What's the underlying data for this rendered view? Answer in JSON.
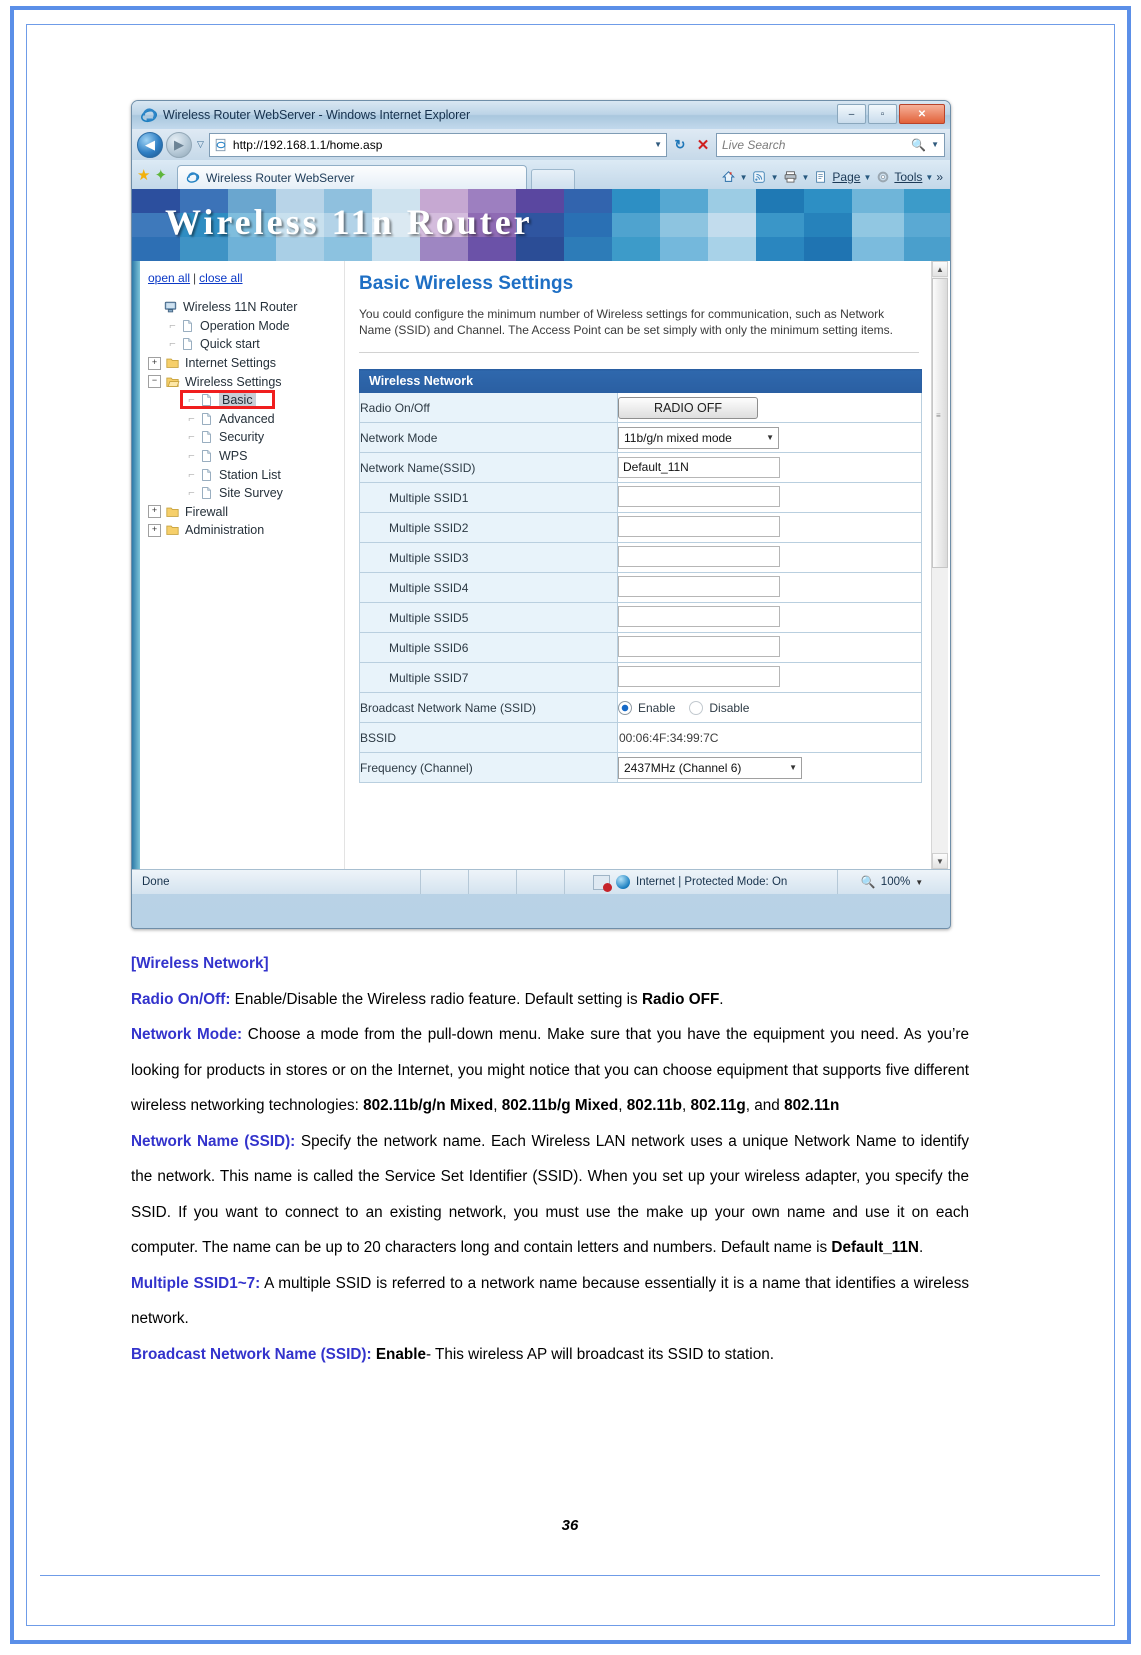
{
  "browser": {
    "window_title": "Wireless Router WebServer - Windows Internet Explorer",
    "minimize_label": "–",
    "maximize_label": "▫",
    "close_label": "✕",
    "back_label": "◀",
    "forward_label": "▶",
    "history_caret": "▽",
    "url": "http://192.168.1.1/home.asp",
    "url_caret": "▼",
    "refresh_label": "↻",
    "stop_label": "✕",
    "search_placeholder": "Live Search",
    "search_icon": "🔍",
    "search_caret": "▼",
    "tab_label": "Wireless Router WebServer",
    "command_bar": [
      {
        "label": "",
        "icon": "home-icon",
        "caret": "▼"
      },
      {
        "label": "",
        "icon": "feeds-icon",
        "caret": "▼"
      },
      {
        "label": "",
        "icon": "print-icon",
        "caret": "▼"
      },
      {
        "label": "Page",
        "icon": "page-icon",
        "caret": "▼"
      },
      {
        "label": "Tools",
        "icon": "tools-icon",
        "caret": "▼"
      },
      {
        "label": "»",
        "icon": "overflow-icon",
        "caret": ""
      }
    ],
    "status": {
      "done": "Done",
      "zone": "Internet | Protected Mode: On",
      "zoom": "100%",
      "zoom_caret": "▼"
    }
  },
  "router": {
    "banner_title": "Wireless 11n Router",
    "open_all": "open all",
    "separator": "|",
    "close_all": "close all",
    "tree": [
      {
        "label": "Wireless 11N Router",
        "level": 1,
        "icon": "computer-icon",
        "expander": "",
        "selected": false
      },
      {
        "label": "Operation Mode",
        "level": 2,
        "icon": "page-icon",
        "expander": "",
        "selected": false
      },
      {
        "label": "Quick start",
        "level": 2,
        "icon": "page-icon",
        "expander": "",
        "selected": false
      },
      {
        "label": "Internet Settings",
        "level": 1,
        "icon": "folder-icon",
        "expander": "+",
        "selected": false
      },
      {
        "label": "Wireless Settings",
        "level": 1,
        "icon": "folder-open-icon",
        "expander": "−",
        "selected": false
      },
      {
        "label": "Basic",
        "level": 3,
        "icon": "page-icon",
        "expander": "",
        "selected": true
      },
      {
        "label": "Advanced",
        "level": 3,
        "icon": "page-icon",
        "expander": "",
        "selected": false
      },
      {
        "label": "Security",
        "level": 3,
        "icon": "page-icon",
        "expander": "",
        "selected": false
      },
      {
        "label": "WPS",
        "level": 3,
        "icon": "page-icon",
        "expander": "",
        "selected": false
      },
      {
        "label": "Station List",
        "level": 3,
        "icon": "page-icon",
        "expander": "",
        "selected": false
      },
      {
        "label": "Site Survey",
        "level": 3,
        "icon": "page-icon",
        "expander": "",
        "selected": false
      },
      {
        "label": "Firewall",
        "level": 1,
        "icon": "folder-icon",
        "expander": "+",
        "selected": false
      },
      {
        "label": "Administration",
        "level": 1,
        "icon": "folder-icon",
        "expander": "+",
        "selected": false
      }
    ],
    "page_title": "Basic Wireless Settings",
    "page_desc": "You could configure the minimum number of Wireless settings for communication, such as Network Name (SSID) and Channel. The Access Point can be set simply with only the minimum setting items.",
    "table_header": "Wireless Network",
    "rows": {
      "radio_label": "Radio On/Off",
      "radio_button": "RADIO OFF",
      "network_mode_label": "Network Mode",
      "network_mode_value": "11b/g/n mixed mode",
      "ssid_label": "Network Name(SSID)",
      "ssid_value": "Default_11N",
      "multi_ssid1_label": "Multiple SSID1",
      "multi_ssid1_value": "",
      "multi_ssid2_label": "Multiple SSID2",
      "multi_ssid2_value": "",
      "multi_ssid3_label": "Multiple SSID3",
      "multi_ssid3_value": "",
      "multi_ssid4_label": "Multiple SSID4",
      "multi_ssid4_value": "",
      "multi_ssid5_label": "Multiple SSID5",
      "multi_ssid5_value": "",
      "multi_ssid6_label": "Multiple SSID6",
      "multi_ssid6_value": "",
      "multi_ssid7_label": "Multiple SSID7",
      "multi_ssid7_value": "",
      "broadcast_label": "Broadcast Network Name (SSID)",
      "broadcast_enable": "Enable",
      "broadcast_disable": "Disable",
      "bssid_label": "BSSID",
      "bssid_value": "00:06:4F:34:99:7C",
      "frequency_label": "Frequency (Channel)",
      "frequency_value": "2437MHz (Channel 6)"
    },
    "scroll_up": "▲",
    "scroll_down": "▼"
  },
  "doc": {
    "section_heading": "[Wireless Network]",
    "radio_heading": "Radio On/Off:",
    "radio_text_1": " Enable/Disable the Wireless radio feature. Default setting is ",
    "radio_bold": "Radio OFF",
    "radio_text_2": ".",
    "mode_heading": "Network Mode:",
    "mode_text_1": " Choose a mode from the pull-down menu. Make sure that you have the equipment you need. As you’re looking for products in stores or on the Internet, you might notice that you can choose equipment that supports five different wireless networking technologies: ",
    "mode_b1": "802.11b/g/n Mixed",
    "mode_sep1": ", ",
    "mode_b2": "802.11b/g Mixed",
    "mode_sep2": ", ",
    "mode_b3": "802.11b",
    "mode_sep3": ", ",
    "mode_b4": "802.11g",
    "mode_sep4": ", and ",
    "mode_b5": "802.11n",
    "ssid_heading": "Network Name (SSID):",
    "ssid_text_1": " Specify the network name. Each Wireless LAN network uses a unique Network Name to identify the network. This name is called the Service Set Identifier (SSID). When you set up your wireless adapter, you specify the SSID. If you want to connect to an existing network, you must use the make up your own name and use it on each computer. The name can be up to 20 characters long and contain letters and numbers. Default name is ",
    "ssid_bold": "Default_11N",
    "ssid_text_2": ".",
    "multi_heading": "Multiple SSID1~7:",
    "multi_text": " A multiple SSID is referred to a network name because essentially it is a name that identifies a wireless network.",
    "broadcast_heading": "Broadcast Network Name (SSID):",
    "broadcast_bold": "Enable",
    "broadcast_text": "- This wireless AP will broadcast its SSID to station.",
    "page_number": "36"
  }
}
